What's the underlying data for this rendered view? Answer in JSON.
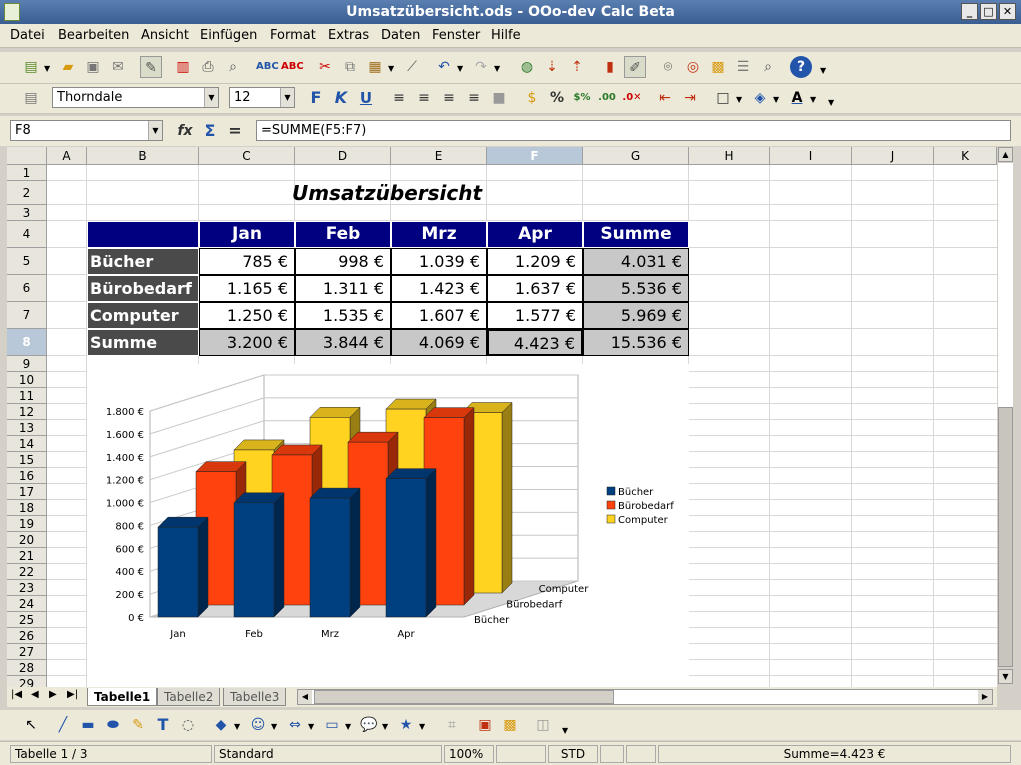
{
  "window": {
    "title": "Umsatzübersicht.ods - OOo-dev Calc Beta"
  },
  "menu": [
    "Datei",
    "Bearbeiten",
    "Ansicht",
    "Einfügen",
    "Format",
    "Extras",
    "Daten",
    "Fenster",
    "Hilfe"
  ],
  "formatting": {
    "font": "Thorndale",
    "size": "12"
  },
  "formula": {
    "cell_ref": "F8",
    "content": "=SUMME(F5:F7)"
  },
  "columns": [
    "A",
    "B",
    "C",
    "D",
    "E",
    "F",
    "G",
    "H",
    "I",
    "J",
    "K"
  ],
  "rows": [
    "1",
    "2",
    "3",
    "4",
    "5",
    "6",
    "7",
    "8",
    "9",
    "10",
    "11",
    "12",
    "13",
    "14",
    "15",
    "16",
    "17",
    "18",
    "19",
    "20",
    "21",
    "22",
    "23",
    "24",
    "25",
    "26",
    "27",
    "28",
    "29"
  ],
  "sheet": {
    "title": "Umsatzübersicht",
    "headers": [
      "Jan",
      "Feb",
      "Mrz",
      "Apr",
      "Summe"
    ],
    "table": [
      {
        "label": "Bücher",
        "values": [
          "785 €",
          "998 €",
          "1.039 €",
          "1.209 €",
          "4.031 €"
        ]
      },
      {
        "label": "Bürobedarf",
        "values": [
          "1.165 €",
          "1.311 €",
          "1.423 €",
          "1.637 €",
          "5.536 €"
        ]
      },
      {
        "label": "Computer",
        "values": [
          "1.250 €",
          "1.535 €",
          "1.607 €",
          "1.577 €",
          "5.969 €"
        ]
      },
      {
        "label": "Summe",
        "values": [
          "3.200 €",
          "3.844 €",
          "4.069 €",
          "4.423 €",
          "15.536 €"
        ]
      }
    ]
  },
  "chart_data": {
    "type": "bar",
    "categories": [
      "Jan",
      "Feb",
      "Mrz",
      "Apr"
    ],
    "series": [
      {
        "name": "Bücher",
        "values": [
          785,
          998,
          1039,
          1209
        ],
        "color": "#003f80"
      },
      {
        "name": "Bürobedarf",
        "values": [
          1165,
          1311,
          1423,
          1637
        ],
        "color": "#ff420e"
      },
      {
        "name": "Computer",
        "values": [
          1250,
          1535,
          1607,
          1577
        ],
        "color": "#ffd320"
      }
    ],
    "yticks": [
      "0 €",
      "200 €",
      "400 €",
      "600 €",
      "800 €",
      "1.000 €",
      "1.200 €",
      "1.400 €",
      "1.600 €",
      "1.800 €"
    ],
    "ylim": [
      0,
      1800
    ],
    "depth_labels": [
      "Bücher",
      "Bürobedarf",
      "Computer"
    ],
    "legend": "right",
    "three_d": true
  },
  "tabs": [
    "Tabelle1",
    "Tabelle2",
    "Tabelle3"
  ],
  "status": {
    "sheet": "Tabelle 1 / 3",
    "style": "Standard",
    "zoom": "100%",
    "mode": "STD",
    "sum": "Summe=4.423 €"
  }
}
